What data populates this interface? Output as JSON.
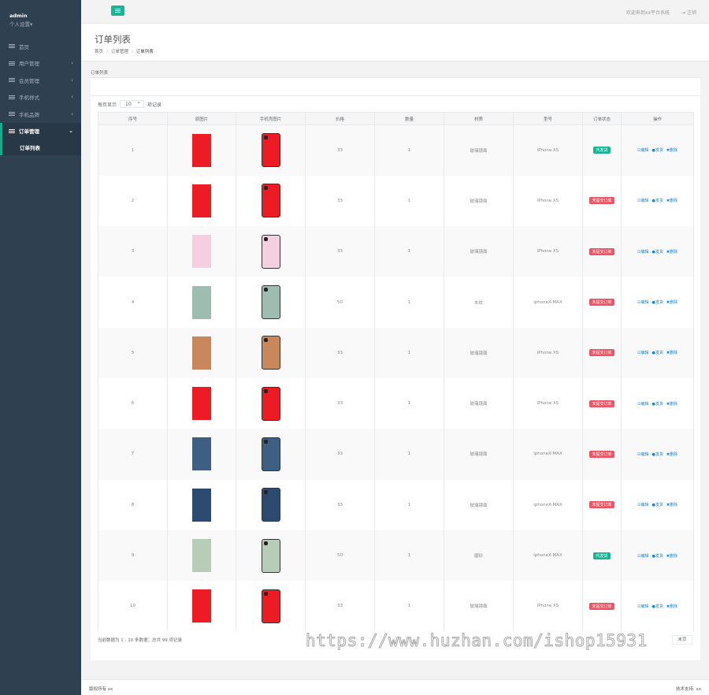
{
  "sidebar": {
    "username": "admin",
    "user_settings": "个人设置▾",
    "items": [
      {
        "label": "首页",
        "arrow": ""
      },
      {
        "label": "用户管理",
        "arrow": "‹"
      },
      {
        "label": "会员管理",
        "arrow": "‹"
      },
      {
        "label": "手机样式",
        "arrow": "‹"
      },
      {
        "label": "手机品牌",
        "arrow": "‹"
      },
      {
        "label": "订单管理",
        "arrow": "⌄"
      }
    ],
    "sub_item": "订单列表"
  },
  "topbar": {
    "welcome": "欢迎来到xx平台系统",
    "logout": "注销"
  },
  "heading": {
    "title": "订单列表",
    "breadcrumb": [
      "首页",
      "订单管理",
      "订单列表"
    ]
  },
  "box": {
    "title": "订单列表",
    "per_page_prefix": "每页显示",
    "per_page_value": "10",
    "per_page_suffix": "项记录",
    "headers": [
      "序号",
      "原图片",
      "手机壳图片",
      "价格",
      "数量",
      "材质",
      "型号",
      "订单状态",
      "操作"
    ],
    "rows": [
      {
        "no": "1",
        "price": "33",
        "qty": "1",
        "material": "玻璃镜面",
        "model": "iPhone XS",
        "status": "代发货",
        "status_color": "#1ab394",
        "case_color": "#ed1c24"
      },
      {
        "no": "2",
        "price": "33",
        "qty": "1",
        "material": "玻璃镜面",
        "model": "iPhone XS",
        "status": "未提交订单",
        "status_color": "#ed5565",
        "case_color": "#ed1c24"
      },
      {
        "no": "3",
        "price": "33",
        "qty": "1",
        "material": "玻璃镜面",
        "model": "iPhone XS",
        "status": "未提交订单",
        "status_color": "#ed5565",
        "case_color": "#f4cfe0"
      },
      {
        "no": "4",
        "price": "50",
        "qty": "1",
        "material": "木纹",
        "model": "iphoneX-MAX",
        "status": "未提交订单",
        "status_color": "#ed5565",
        "case_color": "#9fbcb0"
      },
      {
        "no": "5",
        "price": "33",
        "qty": "1",
        "material": "玻璃镜面",
        "model": "iPhone XS",
        "status": "未提交订单",
        "status_color": "#ed5565",
        "case_color": "#c9885c"
      },
      {
        "no": "6",
        "price": "33",
        "qty": "1",
        "material": "玻璃镜面",
        "model": "iPhone XS",
        "status": "未提交订单",
        "status_color": "#ed5565",
        "case_color": "#ed1c24"
      },
      {
        "no": "7",
        "price": "33",
        "qty": "1",
        "material": "玻璃镜面",
        "model": "iphoneX-MAX",
        "status": "未提交订单",
        "status_color": "#ed5565",
        "case_color": "#3f5f82"
      },
      {
        "no": "8",
        "price": "33",
        "qty": "1",
        "material": "玻璃镜面",
        "model": "iphoneX-MAX",
        "status": "未提交订单",
        "status_color": "#ed5565",
        "case_color": "#2d4a70"
      },
      {
        "no": "9",
        "price": "50",
        "qty": "1",
        "material": "磨砂",
        "model": "iphoneX-MAX",
        "status": "代发货",
        "status_color": "#1ab394",
        "case_color": "#b8cdb8"
      },
      {
        "no": "10",
        "price": "33",
        "qty": "1",
        "material": "玻璃镜面",
        "model": "iPhone XS",
        "status": "未提交订单",
        "status_color": "#ed5565",
        "case_color": "#ed1c24"
      }
    ],
    "actions": [
      "☑编辑",
      "●发货",
      "✖删除"
    ],
    "footer_info": "当前数据为 1 - 10 条数据；总共 99 项记录",
    "next_page": "末页"
  },
  "watermark": "https://www.huzhan.com/ishop15931",
  "footer": {
    "copyright": "版权所有 xx",
    "tech_support": "技术支持: xx"
  }
}
